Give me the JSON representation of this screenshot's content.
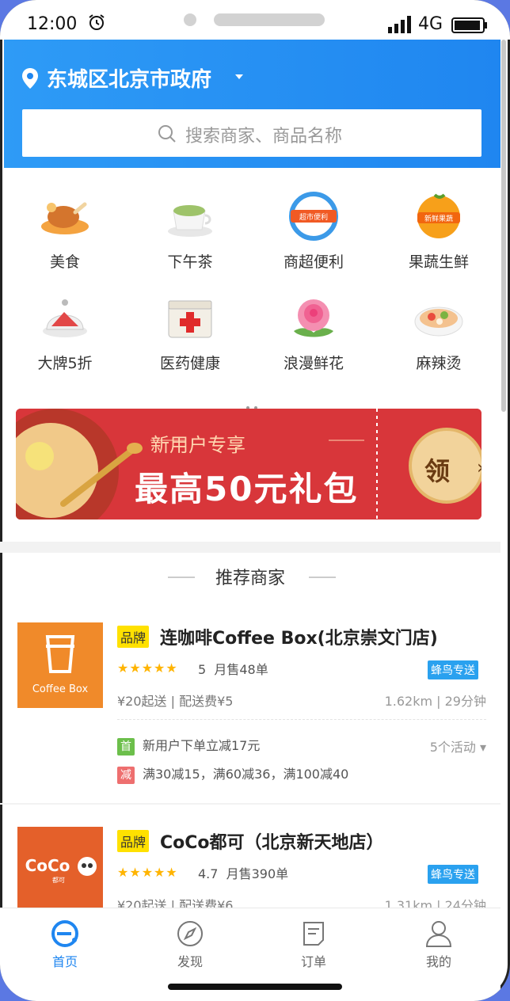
{
  "status_bar": {
    "time": "12:00",
    "network": "4G"
  },
  "header": {
    "location": "东城区北京市政府",
    "search_placeholder": "搜索商家、商品名称"
  },
  "categories": [
    {
      "label": "美食",
      "icon": "roast-chicken-icon"
    },
    {
      "label": "下午茶",
      "icon": "latte-icon"
    },
    {
      "label": "商超便利",
      "icon": "supermarket-icon"
    },
    {
      "label": "果蔬生鲜",
      "icon": "fruit-icon"
    },
    {
      "label": "大牌5折",
      "icon": "cake-icon"
    },
    {
      "label": "医药健康",
      "icon": "medicine-box-icon"
    },
    {
      "label": "浪漫鲜花",
      "icon": "rose-icon"
    },
    {
      "label": "麻辣烫",
      "icon": "spicy-hotpot-icon"
    }
  ],
  "category_badges": {
    "supermarket": "超市便利",
    "fruit": "新鲜果蔬"
  },
  "banner": {
    "subtitle": "新用户专享",
    "title": "最高50元礼包",
    "coupon_label": "领",
    "coupon_arrow": "›"
  },
  "section": {
    "title": "推荐商家"
  },
  "shops": [
    {
      "logo_text": "Coffee Box",
      "brand_tag": "品牌",
      "name": "连咖啡Coffee Box(北京崇文门店)",
      "stars": "★★★★★",
      "rating": "5",
      "monthly_sales": "月售48单",
      "delivery_tag": "蜂鸟专送",
      "min_order": "¥20起送",
      "delivery_fee": "配送费¥5",
      "distance": "1.62km",
      "time": "29分钟",
      "promos": [
        {
          "tag": "首",
          "text": "新用户下单立减17元",
          "color": "#6cbf4b"
        },
        {
          "tag": "减",
          "text": "满30减15，满60减36，满100减40",
          "color": "#ee6f6f"
        }
      ],
      "activities": "5个活动"
    },
    {
      "logo_text": "CoCo",
      "logo_sub": "都可",
      "brand_tag": "品牌",
      "name": "CoCo都可（北京新天地店）",
      "stars": "★★★★★",
      "rating": "4.7",
      "monthly_sales": "月售390单",
      "delivery_tag": "蜂鸟专送",
      "min_order": "¥20起送",
      "delivery_fee": "配送费¥6",
      "distance": "1.31km",
      "time": "24分钟"
    }
  ],
  "tabs": [
    {
      "label": "首页",
      "icon": "home-icon",
      "active": true
    },
    {
      "label": "发现",
      "icon": "compass-icon",
      "active": false
    },
    {
      "label": "订单",
      "icon": "order-icon",
      "active": false
    },
    {
      "label": "我的",
      "icon": "profile-icon",
      "active": false
    }
  ],
  "colors": {
    "header_blue": "#1f86f0",
    "active_tab": "#1f86f0",
    "star": "#ffb400",
    "brand_tag": "#ffe100",
    "delivery_tag": "#2aa1ef"
  }
}
